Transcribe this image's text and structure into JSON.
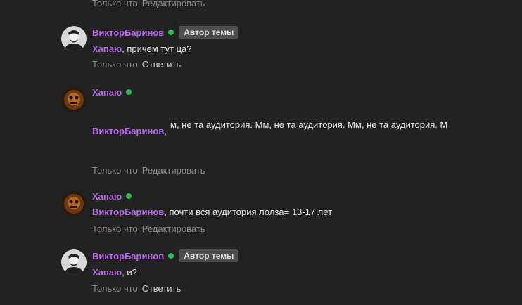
{
  "top_meta": {
    "time": "Только что",
    "edit": "Редактировать"
  },
  "comments": [
    {
      "author": "ВикторБаринов",
      "badge": "Автор темы",
      "mention": "Хапаю",
      "text": ", причем тут ца?",
      "time": "Только что",
      "action": "Ответить"
    },
    {
      "author": "Хапаю",
      "mention": "ВикторБаринов",
      "text": "м, не та аудитория. Мм, не та аудитория. Мм, не та аудитория. М",
      "time": "Только что",
      "action": "Редактировать"
    },
    {
      "author": "Хапаю",
      "mention": "ВикторБаринов",
      "text": ", почти вся аудитория лолза= 13-17 лет",
      "time": "Только что",
      "action": "Редактировать"
    },
    {
      "author": "ВикторБаринов",
      "badge": "Автор темы",
      "mention": "Хапаю",
      "text": ", и?",
      "time": "Только что",
      "action": "Ответить"
    }
  ],
  "colors": {
    "background": "#222222",
    "author": "#b86ae9",
    "online": "#2fbb5d",
    "badge_bg": "#4e4e4e"
  },
  "icons": {
    "online": "online-dot-icon"
  }
}
